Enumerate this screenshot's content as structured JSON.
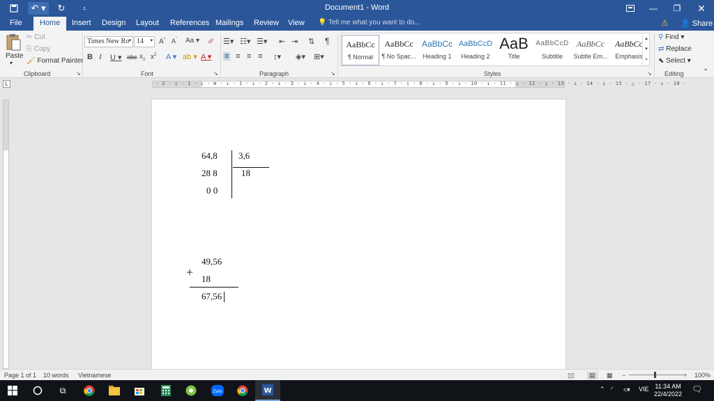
{
  "window": {
    "title": "Document1 - Word",
    "share": "Share",
    "tell_me": "Tell me what you want to do..."
  },
  "tabs": [
    "File",
    "Home",
    "Insert",
    "Design",
    "Layout",
    "References",
    "Mailings",
    "Review",
    "View"
  ],
  "clipboard": {
    "paste": "Paste",
    "cut": "Cut",
    "copy": "Copy",
    "format_painter": "Format Painter",
    "group": "Clipboard"
  },
  "font": {
    "family": "Times New Ro",
    "size": "14",
    "group": "Font"
  },
  "paragraph": {
    "group": "Paragraph"
  },
  "styles": {
    "group": "Styles",
    "items": [
      {
        "sample": "AaBbCc",
        "name": "¶ Normal"
      },
      {
        "sample": "AaBbCc",
        "name": "¶ No Spac..."
      },
      {
        "sample": "AaBbCc",
        "name": "Heading 1"
      },
      {
        "sample": "AaBbCcD",
        "name": "Heading 2"
      },
      {
        "sample": "AaB",
        "name": "Title"
      },
      {
        "sample": "AaBbCcD",
        "name": "Subtitle"
      },
      {
        "sample": "AaBbCc",
        "name": "Subtle Em..."
      },
      {
        "sample": "AaBbCc",
        "name": "Emphasis"
      }
    ]
  },
  "editing": {
    "find": "Find",
    "replace": "Replace",
    "select": "Select",
    "group": "Editing"
  },
  "ruler": {
    "labels": "· 2 · ı · 1 · ı · ⊠ · ı · 1 · ı · 2 · ı · 3 · ı · 4 · ı · 5 · ı · 6 · ı · 7 · ı · 8 · ı · 9 · ı · 10 · ı · 11 · ı · 12 · ı · 13 · ı · 14 · ı · 15 · △ · 17 · ı · 18 ·"
  },
  "document": {
    "division": {
      "dividend": "64,8",
      "divisor": "3,6",
      "remainder1": "28 8",
      "quotient": "18",
      "remainder2": "0 0"
    },
    "addition": {
      "operand1": "49,56",
      "sign": "+",
      "operand2": "18",
      "result": "67,56"
    }
  },
  "status": {
    "page": "Page 1 of 1",
    "words": "10 words",
    "language": "Vietnamese",
    "zoom": "100%"
  },
  "taskbar": {
    "lang": "VIE",
    "time": "11:34 AM",
    "date": "22/4/2022"
  }
}
